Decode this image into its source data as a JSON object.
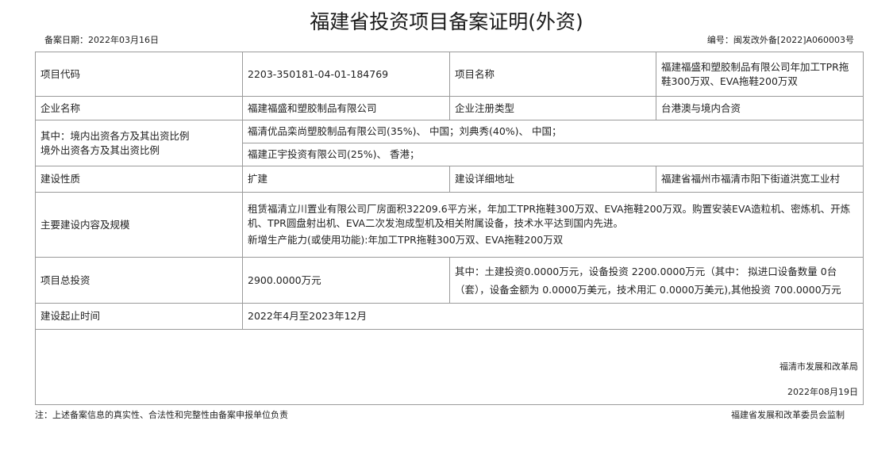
{
  "document": {
    "title": "福建省投资项目备案证明(外资)",
    "record_date_label": "备案日期：",
    "record_date": "2022年03月16日",
    "number_label": "编号：",
    "number": "闽发改外备[2022]A060003号"
  },
  "table": {
    "project_code_label": "项目代码",
    "project_code": "2203-350181-04-01-184769",
    "project_name_label": "项目名称",
    "project_name": "福建福盛和塑胶制品有限公司年加工TPR拖鞋300万双、EVA拖鞋200万双",
    "company_name_label": "企业名称",
    "company_name": "福建福盛和塑胶制品有限公司",
    "company_type_label": "企业注册类型",
    "company_type": "台港澳与境内合资",
    "investors_label_1": "其中：境内出资各方及其出资比例",
    "investors_label_2": "境外出资各方及其出资比例",
    "domestic_investors": "福清优品栾尚塑胶制品有限公司(35%)、 中国；刘典秀(40%)、 中国；",
    "foreign_investors": "福建正宇投资有限公司(25%)、 香港；",
    "construction_type_label": "建设性质",
    "construction_type": "扩建",
    "address_label": "建设详细地址",
    "address": "福建省福州市福清市阳下街道洪宽工业村",
    "content_label": "主要建设内容及规模",
    "content_text": "租赁福清立川置业有限公司厂房面积32209.6平方米，年加工TPR拖鞋300万双、EVA拖鞋200万双。购置安装EVA造粒机、密炼机、开炼机、TPR圆盘射出机、EVA二次发泡成型机及相关附属设备，技术水平达到国内先进。",
    "capacity_text": "新增生产能力(或使用功能):年加工TPR拖鞋300万双、EVA拖鞋200万双",
    "total_investment_label": "项目总投资",
    "total_investment": "2900.0000万元",
    "investment_detail": "其中：土建投资0.0000万元，设备投资 2200.0000万元（其中： 拟进口设备数量 0台（套），设备金额为 0.0000万美元，技术用汇 0.0000万美元),其他投资 700.0000万元",
    "period_label": "建设起止时间",
    "period": "2022年4月至2023年12月"
  },
  "signature": {
    "org": "福清市发展和改革局",
    "date": "2022年08月19日"
  },
  "footer": {
    "note": "注：上述备案信息的真实性、合法性和完整性由备案申报单位负责",
    "supervisor": "福建省发展和改革委员会监制"
  }
}
